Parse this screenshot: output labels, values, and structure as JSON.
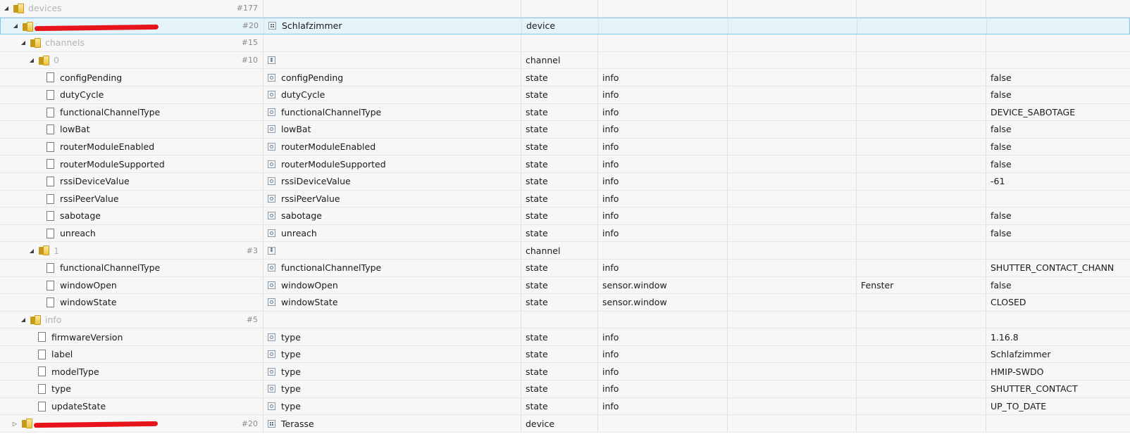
{
  "tree": [
    {
      "label": "devices",
      "level": 0,
      "type": "folder",
      "expanded": true,
      "count": "#177",
      "label_grey": true
    },
    {
      "label": "",
      "level": 1,
      "type": "folder",
      "expanded": true,
      "count": "#20",
      "name": "Schlafzimmer",
      "role_icon": "device",
      "obj_type": "device",
      "redacted": true,
      "selected": true
    },
    {
      "label": "channels",
      "level": 2,
      "type": "folder",
      "expanded": true,
      "count": "#15",
      "label_grey": true
    },
    {
      "label": "0",
      "level": 3,
      "type": "folder",
      "expanded": true,
      "count": "#10",
      "name": "",
      "role_icon": "channel",
      "obj_type": "channel",
      "label_grey": true
    },
    {
      "label": "configPending",
      "level": 4,
      "type": "file",
      "name": "configPending",
      "role_icon": "state",
      "obj_type": "state",
      "role": "info",
      "value": "false"
    },
    {
      "label": "dutyCycle",
      "level": 4,
      "type": "file",
      "name": "dutyCycle",
      "role_icon": "state",
      "obj_type": "state",
      "role": "info",
      "value": "false"
    },
    {
      "label": "functionalChannelType",
      "level": 4,
      "type": "file",
      "name": "functionalChannelType",
      "role_icon": "state",
      "obj_type": "state",
      "role": "info",
      "value": "DEVICE_SABOTAGE"
    },
    {
      "label": "lowBat",
      "level": 4,
      "type": "file",
      "name": "lowBat",
      "role_icon": "state",
      "obj_type": "state",
      "role": "info",
      "value": "false"
    },
    {
      "label": "routerModuleEnabled",
      "level": 4,
      "type": "file",
      "name": "routerModuleEnabled",
      "role_icon": "state",
      "obj_type": "state",
      "role": "info",
      "value": "false"
    },
    {
      "label": "routerModuleSupported",
      "level": 4,
      "type": "file",
      "name": "routerModuleSupported",
      "role_icon": "state",
      "obj_type": "state",
      "role": "info",
      "value": "false"
    },
    {
      "label": "rssiDeviceValue",
      "level": 4,
      "type": "file",
      "name": "rssiDeviceValue",
      "role_icon": "state",
      "obj_type": "state",
      "role": "info",
      "value": "-61"
    },
    {
      "label": "rssiPeerValue",
      "level": 4,
      "type": "file",
      "name": "rssiPeerValue",
      "role_icon": "state",
      "obj_type": "state",
      "role": "info",
      "value": ""
    },
    {
      "label": "sabotage",
      "level": 4,
      "type": "file",
      "name": "sabotage",
      "role_icon": "state",
      "obj_type": "state",
      "role": "info",
      "value": "false"
    },
    {
      "label": "unreach",
      "level": 4,
      "type": "file",
      "name": "unreach",
      "role_icon": "state",
      "obj_type": "state",
      "role": "info",
      "value": "false"
    },
    {
      "label": "1",
      "level": 3,
      "type": "folder",
      "expanded": true,
      "count": "#3",
      "name": "",
      "role_icon": "channel",
      "obj_type": "channel",
      "label_grey": true
    },
    {
      "label": "functionalChannelType",
      "level": 4,
      "type": "file",
      "name": "functionalChannelType",
      "role_icon": "state",
      "obj_type": "state",
      "role": "info",
      "value": "SHUTTER_CONTACT_CHANN"
    },
    {
      "label": "windowOpen",
      "level": 4,
      "type": "file",
      "name": "windowOpen",
      "role_icon": "state",
      "obj_type": "state",
      "role": "sensor.window",
      "room": "Fenster",
      "value": "false"
    },
    {
      "label": "windowState",
      "level": 4,
      "type": "file",
      "name": "windowState",
      "role_icon": "state",
      "obj_type": "state",
      "role": "sensor.window",
      "value": "CLOSED"
    },
    {
      "label": "info",
      "level": 2,
      "type": "folder",
      "expanded": true,
      "count": "#5",
      "label_grey": true
    },
    {
      "label": "firmwareVersion",
      "level": 3,
      "type": "file",
      "name": "type",
      "role_icon": "state",
      "obj_type": "state",
      "role": "info",
      "value": "1.16.8"
    },
    {
      "label": "label",
      "level": 3,
      "type": "file",
      "name": "type",
      "role_icon": "state",
      "obj_type": "state",
      "role": "info",
      "value": "Schlafzimmer"
    },
    {
      "label": "modelType",
      "level": 3,
      "type": "file",
      "name": "type",
      "role_icon": "state",
      "obj_type": "state",
      "role": "info",
      "value": "HMIP-SWDO"
    },
    {
      "label": "type",
      "level": 3,
      "type": "file",
      "name": "type",
      "role_icon": "state",
      "obj_type": "state",
      "role": "info",
      "value": "SHUTTER_CONTACT"
    },
    {
      "label": "updateState",
      "level": 3,
      "type": "file",
      "name": "type",
      "role_icon": "state",
      "obj_type": "state",
      "role": "info",
      "value": "UP_TO_DATE"
    },
    {
      "label": "",
      "level": 1,
      "type": "folder",
      "expanded": false,
      "count": "#20",
      "name": "Terasse",
      "role_icon": "device",
      "obj_type": "device",
      "redacted": true
    }
  ],
  "colors": {
    "redaction": "#e8141c",
    "selected_bg": "#e5f3fb",
    "selected_border": "#80c8f0",
    "folder": "#eec443"
  }
}
